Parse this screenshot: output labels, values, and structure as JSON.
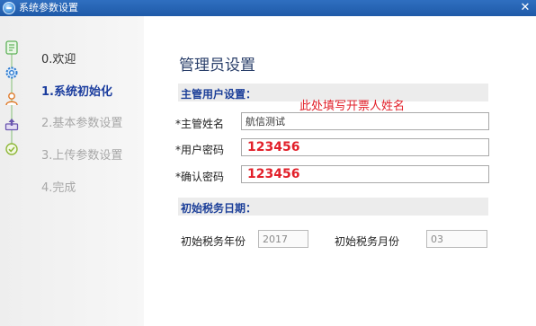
{
  "window": {
    "title": "系统参数设置",
    "close_glyph": "✕"
  },
  "steps": [
    {
      "label": "0.欢迎",
      "state": "done"
    },
    {
      "label": "1.系统初始化",
      "state": "active"
    },
    {
      "label": "2.基本参数设置",
      "state": "pending"
    },
    {
      "label": "3.上传参数设置",
      "state": "pending"
    },
    {
      "label": "4.完成",
      "state": "pending"
    }
  ],
  "step_icons": [
    "document-icon",
    "gear-icon",
    "user-icon",
    "upload-icon",
    "check-icon"
  ],
  "main": {
    "title": "管理员设置",
    "admin_section": "主管用户设置：",
    "name_label": "*主管姓名",
    "name_value": "航信测试",
    "name_hint": "此处填写开票人姓名",
    "password_label": "*用户密码",
    "password_value": "123456",
    "confirm_label": "*确认密码",
    "confirm_value": "123456",
    "tax_section": "初始税务日期：",
    "year_label": "初始税务年份",
    "year_value": "2017",
    "month_label": "初始税务月份",
    "month_value": "03"
  },
  "colors": {
    "titlebar": "#1f5aa8",
    "section_text": "#1c3f99",
    "active_step": "#1a3c9e",
    "hint_red": "#e2202a"
  }
}
